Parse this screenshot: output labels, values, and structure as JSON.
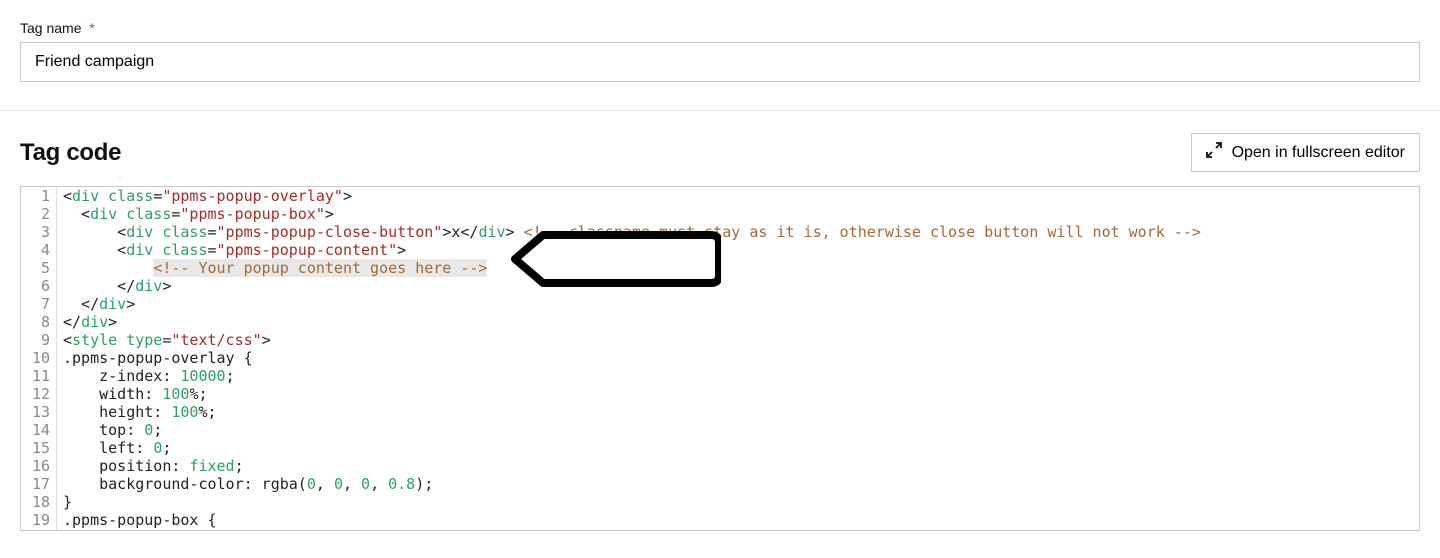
{
  "tag_name_field": {
    "label": "Tag name",
    "required_marker": "*",
    "value": "Friend campaign"
  },
  "tag_code_section": {
    "title": "Tag code",
    "fullscreen_button_label": "Open in fullscreen editor"
  },
  "code": {
    "lines": [
      [
        {
          "t": "plain",
          "v": "<"
        },
        {
          "t": "attr",
          "v": "div class"
        },
        {
          "t": "plain",
          "v": "="
        },
        {
          "t": "val",
          "v": "\"ppms-popup-overlay\""
        },
        {
          "t": "plain",
          "v": ">"
        }
      ],
      [
        {
          "t": "plain",
          "v": "  <"
        },
        {
          "t": "attr",
          "v": "div class"
        },
        {
          "t": "plain",
          "v": "="
        },
        {
          "t": "val",
          "v": "\"ppms-popup-box\""
        },
        {
          "t": "plain",
          "v": ">"
        }
      ],
      [
        {
          "t": "plain",
          "v": "      <"
        },
        {
          "t": "attr",
          "v": "div class"
        },
        {
          "t": "plain",
          "v": "="
        },
        {
          "t": "val",
          "v": "\"ppms-popup-close-button\""
        },
        {
          "t": "plain",
          "v": ">x</"
        },
        {
          "t": "attr",
          "v": "div"
        },
        {
          "t": "plain",
          "v": "> "
        },
        {
          "t": "cmt",
          "v": "<!-- classname must stay as it is, otherwise close button will not work -->"
        }
      ],
      [
        {
          "t": "plain",
          "v": "      <"
        },
        {
          "t": "attr",
          "v": "div class"
        },
        {
          "t": "plain",
          "v": "="
        },
        {
          "t": "val",
          "v": "\"ppms-popup-content\""
        },
        {
          "t": "plain",
          "v": ">"
        }
      ],
      [
        {
          "t": "plain",
          "v": "          "
        },
        {
          "t": "cmt",
          "v": "<!-- Your popup content goes here -->",
          "hl": true
        }
      ],
      [
        {
          "t": "plain",
          "v": "      </"
        },
        {
          "t": "attr",
          "v": "div"
        },
        {
          "t": "plain",
          "v": ">"
        }
      ],
      [
        {
          "t": "plain",
          "v": "  </"
        },
        {
          "t": "attr",
          "v": "div"
        },
        {
          "t": "plain",
          "v": ">"
        }
      ],
      [
        {
          "t": "plain",
          "v": "</"
        },
        {
          "t": "attr",
          "v": "div"
        },
        {
          "t": "plain",
          "v": ">"
        }
      ],
      [
        {
          "t": "plain",
          "v": "<"
        },
        {
          "t": "attr",
          "v": "style type"
        },
        {
          "t": "plain",
          "v": "="
        },
        {
          "t": "val",
          "v": "\"text/css\""
        },
        {
          "t": "plain",
          "v": ">"
        }
      ],
      [
        {
          "t": "plain",
          "v": ".ppms-popup-overlay {"
        }
      ],
      [
        {
          "t": "plain",
          "v": "    z-index: "
        },
        {
          "t": "num",
          "v": "10000"
        },
        {
          "t": "plain",
          "v": ";"
        }
      ],
      [
        {
          "t": "plain",
          "v": "    width: "
        },
        {
          "t": "num",
          "v": "100"
        },
        {
          "t": "plain",
          "v": "%;"
        }
      ],
      [
        {
          "t": "plain",
          "v": "    height: "
        },
        {
          "t": "num",
          "v": "100"
        },
        {
          "t": "plain",
          "v": "%;"
        }
      ],
      [
        {
          "t": "plain",
          "v": "    top: "
        },
        {
          "t": "num",
          "v": "0"
        },
        {
          "t": "plain",
          "v": ";"
        }
      ],
      [
        {
          "t": "plain",
          "v": "    left: "
        },
        {
          "t": "num",
          "v": "0"
        },
        {
          "t": "plain",
          "v": ";"
        }
      ],
      [
        {
          "t": "plain",
          "v": "    position: "
        },
        {
          "t": "num",
          "v": "fixed"
        },
        {
          "t": "plain",
          "v": ";"
        }
      ],
      [
        {
          "t": "plain",
          "v": "    background-color: rgba("
        },
        {
          "t": "num",
          "v": "0"
        },
        {
          "t": "plain",
          "v": ", "
        },
        {
          "t": "num",
          "v": "0"
        },
        {
          "t": "plain",
          "v": ", "
        },
        {
          "t": "num",
          "v": "0"
        },
        {
          "t": "plain",
          "v": ", "
        },
        {
          "t": "num",
          "v": "0.8"
        },
        {
          "t": "plain",
          "v": ");"
        }
      ],
      [
        {
          "t": "plain",
          "v": "}"
        }
      ],
      [
        {
          "t": "plain",
          "v": ".ppms-popup-box {"
        }
      ]
    ]
  }
}
